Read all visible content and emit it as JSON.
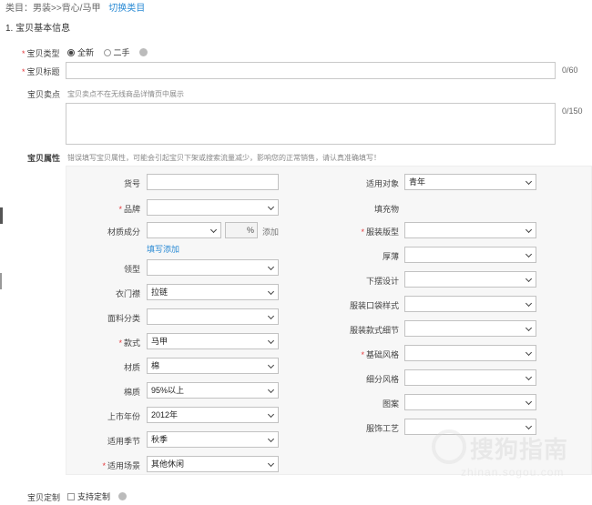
{
  "breadcrumb": {
    "category": "类目：男装>>背心/马甲",
    "switch_label": "切换类目"
  },
  "section1": {
    "title": "1. 宝贝基本信息"
  },
  "item_type": {
    "label": "宝贝类型",
    "options": [
      "全新",
      "二手"
    ],
    "selected": "全新"
  },
  "item_title": {
    "label": "宝贝标题",
    "value": "",
    "counter": "0/60"
  },
  "selling_point": {
    "label": "宝贝卖点",
    "hint": "宝贝卖点不在无线商品详情页中展示",
    "value": "",
    "counter": "0/150"
  },
  "attributes": {
    "label": "宝贝属性",
    "warning": "错误填写宝贝属性，可能会引起宝贝下架或搜索流量减少，影响您的正常销售，请认真准确填写！",
    "left": [
      {
        "key": "goods_no",
        "label": "货号",
        "required": false,
        "value": "",
        "kind": "text"
      },
      {
        "key": "brand",
        "label": "品牌",
        "required": true,
        "value": "",
        "kind": "select"
      },
      {
        "key": "material",
        "label": "材质成分",
        "required": false,
        "value": "",
        "kind": "material"
      },
      {
        "key": "collar",
        "label": "领型",
        "required": false,
        "value": "",
        "kind": "select"
      },
      {
        "key": "placket",
        "label": "衣门襟",
        "required": false,
        "value": "拉链",
        "kind": "select"
      },
      {
        "key": "fabric",
        "label": "面料分类",
        "required": false,
        "value": "",
        "kind": "select"
      },
      {
        "key": "style",
        "label": "款式",
        "required": true,
        "value": "马甲",
        "kind": "select"
      },
      {
        "key": "texture",
        "label": "材质",
        "required": false,
        "value": "棉",
        "kind": "select"
      },
      {
        "key": "cotton",
        "label": "棉质",
        "required": false,
        "value": "95%以上",
        "kind": "select"
      },
      {
        "key": "year",
        "label": "上市年份",
        "required": false,
        "value": "2012年",
        "kind": "select"
      },
      {
        "key": "season",
        "label": "适用季节",
        "required": false,
        "value": "秋季",
        "kind": "select"
      },
      {
        "key": "scene",
        "label": "适用场景",
        "required": true,
        "value": "其他休闲",
        "kind": "select"
      }
    ],
    "material_percent": "%",
    "material_add": "添加",
    "fill_add": "填写添加",
    "right": [
      {
        "key": "target",
        "label": "适用对象",
        "required": false,
        "value": "青年"
      },
      {
        "key": "filling",
        "label": "填充物",
        "required": false,
        "value": "",
        "kind": "none"
      },
      {
        "key": "fit",
        "label": "服装版型",
        "required": true,
        "value": ""
      },
      {
        "key": "thickness",
        "label": "厚薄",
        "required": false,
        "value": ""
      },
      {
        "key": "hem",
        "label": "下摆设计",
        "required": false,
        "value": ""
      },
      {
        "key": "pocket",
        "label": "服装口袋样式",
        "required": false,
        "value": ""
      },
      {
        "key": "detail",
        "label": "服装款式细节",
        "required": false,
        "value": ""
      },
      {
        "key": "basic_style",
        "label": "基础风格",
        "required": true,
        "value": ""
      },
      {
        "key": "sub_style",
        "label": "细分风格",
        "required": false,
        "value": ""
      },
      {
        "key": "pattern",
        "label": "图案",
        "required": false,
        "value": ""
      },
      {
        "key": "craft",
        "label": "服饰工艺",
        "required": false,
        "value": ""
      }
    ]
  },
  "customize": {
    "label": "宝贝定制",
    "checkbox_label": "支持定制"
  },
  "watermark": {
    "text": "搜狗指南",
    "url": "zhinan.sogou.com"
  }
}
